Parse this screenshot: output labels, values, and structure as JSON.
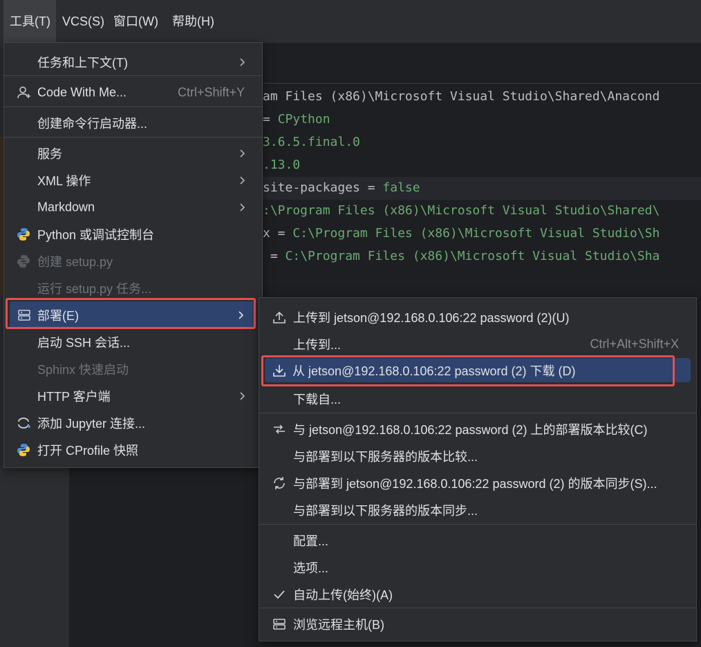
{
  "menubar": {
    "items": [
      {
        "label": "工具(T)",
        "active": true
      },
      {
        "label": "VCS(S)",
        "active": false
      },
      {
        "label": "窗口(W)",
        "active": false
      },
      {
        "label": "帮助(H)",
        "active": false
      }
    ]
  },
  "editor": {
    "lines": [
      [
        "am Files (x86)\\Microsoft Visual Studio\\Shared\\Anacond",
        ""
      ],
      [
        "= ",
        "CPython"
      ],
      [
        "3.6.5.final.0",
        ""
      ],
      [
        ".13.0",
        ""
      ],
      [
        "site-packages = ",
        "false"
      ],
      [
        ":\\Program Files (x86)\\Microsoft Visual Studio\\Shared\\",
        ""
      ],
      [
        "x = ",
        "C:\\Program Files (x86)\\Microsoft Visual Studio\\Sh"
      ],
      [
        " = ",
        "C:\\Program Files (x86)\\Microsoft Visual Studio\\Sha"
      ]
    ]
  },
  "tools_menu": {
    "items": [
      {
        "label": "任务和上下文(T)",
        "submenu": true
      },
      {
        "label": "Code With Me...",
        "shortcut": "Ctrl+Shift+Y",
        "icon": "code-with-me-icon"
      },
      {
        "label": "创建命令行启动器..."
      },
      {
        "label": "服务",
        "submenu": true
      },
      {
        "label": "XML 操作",
        "submenu": true
      },
      {
        "label": "Markdown",
        "submenu": true
      },
      {
        "label": "Python 或调试控制台",
        "icon": "python-icon"
      },
      {
        "label": "创建 setup.py",
        "disabled": true,
        "icon": "python-icon"
      },
      {
        "label": "运行 setup.py 任务...",
        "disabled": true
      },
      {
        "label": "部署(E)",
        "submenu": true,
        "selected": true,
        "icon": "server-icon"
      },
      {
        "label": "启动 SSH 会话..."
      },
      {
        "label": "Sphinx 快速启动",
        "disabled": true
      },
      {
        "label": "HTTP 客户端",
        "submenu": true
      },
      {
        "label": "添加 Jupyter 连接...",
        "icon": "jupyter-icon"
      },
      {
        "label": "打开 CProfile 快照",
        "icon": "python-icon"
      }
    ]
  },
  "deploy_menu": {
    "items": [
      {
        "label": "上传到 jetson@192.168.0.106:22 password (2)(U)",
        "icon": "upload-icon"
      },
      {
        "label": "上传到...",
        "shortcut": "Ctrl+Alt+Shift+X"
      },
      {
        "label": "从 jetson@192.168.0.106:22 password (2) 下载 (D)",
        "icon": "download-icon",
        "selected": true
      },
      {
        "label": "下载自..."
      },
      {
        "label": "与 jetson@192.168.0.106:22 password (2) 上的部署版本比较(C)",
        "icon": "compare-icon"
      },
      {
        "label": "与部署到以下服务器的版本比较..."
      },
      {
        "label": "与部署到 jetson@192.168.0.106:22 password (2) 的版本同步(S)...",
        "icon": "sync-icon"
      },
      {
        "label": "与部署到以下服务器的版本同步..."
      },
      {
        "label": "配置..."
      },
      {
        "label": "选项..."
      },
      {
        "label": "自动上传(始终)(A)",
        "icon": "check-icon"
      },
      {
        "label": "浏览远程主机(B)",
        "icon": "server-icon"
      }
    ]
  },
  "colors": {
    "menu_bg": "#2b2d30",
    "selection": "#2e436e",
    "highlight_box": "#e35050",
    "code_green": "#6aab73"
  }
}
